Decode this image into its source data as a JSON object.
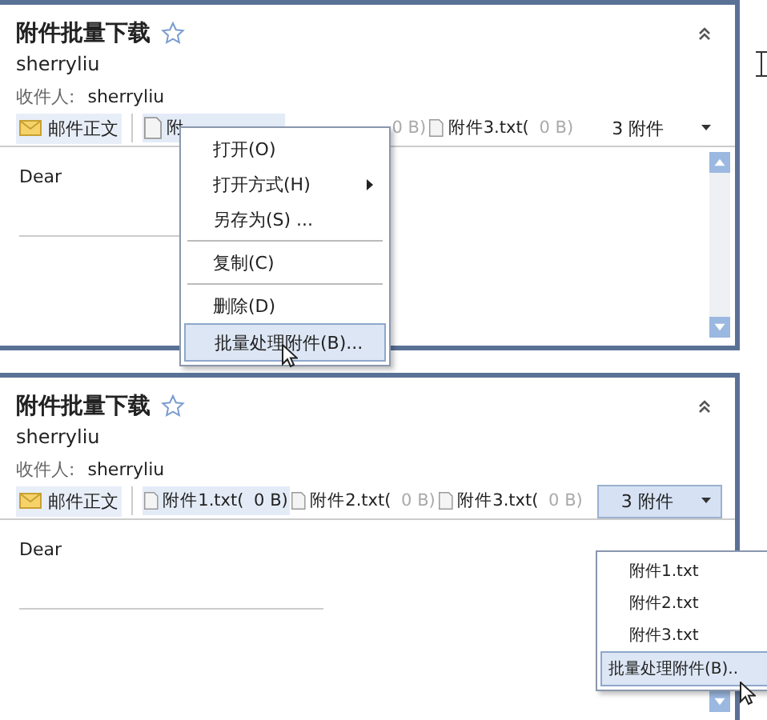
{
  "panels": [
    {
      "title": "附件批量下载",
      "starred": false,
      "sender": "sherryliu",
      "recipient_label": "收件人:",
      "recipient": "sherryliu",
      "body_tab": "邮件正文",
      "attachments": [
        {
          "name": "附",
          "selected": true
        },
        {
          "size": "0 B)",
          "selected": false
        },
        {
          "name": "附件3.txt(",
          "size": " 0 B)",
          "selected": false
        }
      ],
      "count": {
        "label": "3 附件",
        "selected": false
      },
      "body": "Dear",
      "menu": {
        "kind": "context",
        "items": [
          {
            "kind": "item",
            "label": "打开(O)",
            "submenu": false,
            "selected": false
          },
          {
            "kind": "item",
            "label": "打开方式(H)",
            "submenu": true,
            "selected": false
          },
          {
            "kind": "item",
            "label": "另存为(S) ...",
            "submenu": false,
            "selected": false
          },
          {
            "kind": "separator"
          },
          {
            "kind": "item",
            "label": "复制(C)",
            "submenu": false,
            "selected": false
          },
          {
            "kind": "separator"
          },
          {
            "kind": "item",
            "label": "删除(D)",
            "submenu": false,
            "selected": false
          },
          {
            "kind": "item",
            "label": "批量处理附件(B)...",
            "submenu": false,
            "selected": true
          }
        ]
      }
    },
    {
      "title": "附件批量下载",
      "starred": false,
      "sender": "sherryliu",
      "recipient_label": "收件人:",
      "recipient": "sherryliu",
      "body_tab": "邮件正文",
      "attachments": [
        {
          "name": "附件1.txt(",
          "size": " 0 B)",
          "selected": true
        },
        {
          "name": "附件2.txt(",
          "size": " 0 B)",
          "selected": false
        },
        {
          "name": "附件3.txt(",
          "size": " 0 B)",
          "selected": false
        }
      ],
      "count": {
        "label": "3 附件",
        "selected": true
      },
      "body": "Dear",
      "menu": {
        "kind": "dropdown",
        "items": [
          {
            "kind": "item",
            "label": "附件1.txt",
            "submenu": false,
            "selected": false
          },
          {
            "kind": "item",
            "label": "附件2.txt",
            "submenu": false,
            "selected": false
          },
          {
            "kind": "item",
            "label": "附件3.txt",
            "submenu": false,
            "selected": false
          },
          {
            "kind": "item",
            "label": "批量处理附件(B)..",
            "submenu": false,
            "selected": true
          }
        ]
      }
    }
  ]
}
